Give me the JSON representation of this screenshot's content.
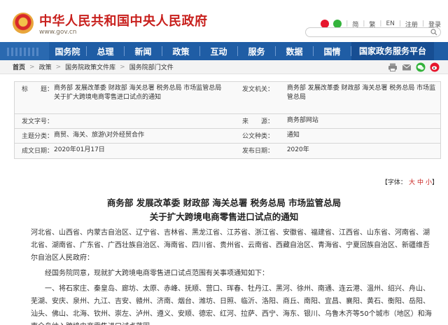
{
  "header": {
    "site_title": "中华人民共和国中央人民政府",
    "site_url": "www.gov.cn",
    "links": [
      "简",
      "繁",
      "EN",
      "注册",
      "登录"
    ]
  },
  "nav": {
    "items": [
      "国务院",
      "总理",
      "新闻",
      "政策",
      "互动",
      "服务",
      "数据",
      "国情",
      "国家政务服务平台"
    ]
  },
  "breadcrumb": {
    "items": [
      "首页",
      "政策",
      "国务院政策文件库",
      "国务院部门文件"
    ]
  },
  "meta": {
    "title_label": "标　　题：",
    "title_value": "商务部 发展改革委 财政部 海关总署 税务总局 市场监管总局关于扩大跨境电商零售进口试点的通知",
    "issuer_label": "发文机关：",
    "issuer_value": "商务部 发展改革委 财政部 海关总署 税务总局 市场监管总局",
    "docno_label": "发文字号：",
    "docno_value": "",
    "source_label": "来　　源：",
    "source_value": "商务部网站",
    "category_label": "主题分类：",
    "category_value": "商贸、海关、旅游\\对外经贸合作",
    "doctype_label": "公文种类：",
    "doctype_value": "通知",
    "written_label": "成文日期：",
    "written_value": "2020年01月17日",
    "published_label": "发布日期：",
    "published_value": "2020年"
  },
  "font_size": {
    "label": "【字体：",
    "large": "大",
    "medium": "中",
    "small": "小",
    "close": "】"
  },
  "article": {
    "title_line1": "商务部 发展改革委 财政部 海关总署 税务总局 市场监管总局",
    "title_line2": "关于扩大跨境电商零售进口试点的通知",
    "recipients": "河北省、山西省、内蒙古自治区、辽宁省、吉林省、黑龙江省、江苏省、浙江省、安徽省、福建省、江西省、山东省、河南省、湖北省、湖南省、广东省、广西壮族自治区、海南省、四川省、贵州省、云南省、西藏自治区、青海省、宁夏回族自治区、新疆维吾尔自治区人民政府：",
    "para1": "经国务院同意，现就扩大跨境电商零售进口试点范围有关事项通知如下：",
    "para2": "一、将石家庄、秦皇岛、廊坊、太原、赤峰、抚顺、营口、珲春、牡丹江、黑河、徐州、南通、连云港、温州、绍兴、舟山、芜湖、安庆、泉州、九江、吉安、赣州、济南、烟台、潍坊、日照、临沂、洛阳、商丘、南阳、宜昌、襄阳、黄石、衡阳、岳阳、汕头、佛山、北海、钦州、崇左、泸州、遵义、安顺、德宏、红河、拉萨、西宁、海东、银川、乌鲁木齐等50个城市（地区）和海南全岛纳入跨境电商零售进口试点范围。"
  },
  "colors": {
    "brand_red": "#c8201d",
    "nav_blue": "#1f5da5"
  }
}
